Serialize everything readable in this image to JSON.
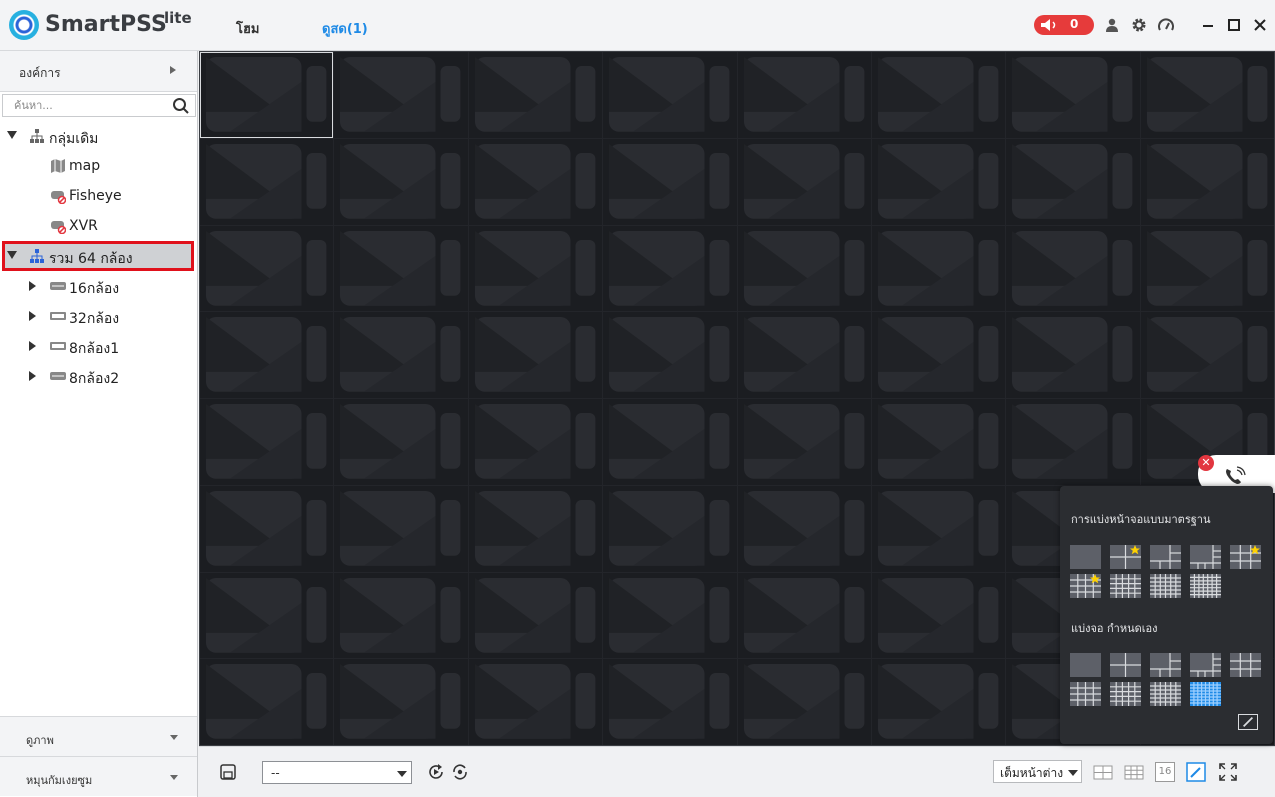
{
  "titlebar": {
    "brand": "SmartPSS",
    "brand_suffix": "lite",
    "tabs": [
      {
        "label": "โฮม"
      },
      {
        "label": "ดูสด(1)"
      }
    ],
    "alarm_count": "0"
  },
  "sidebar": {
    "org_header": "องค์การ",
    "search_placeholder": "ค้นหา...",
    "tree": [
      {
        "label": "กลุ่มเดิม",
        "icon": "org-tree-icon"
      },
      {
        "label": "map",
        "icon": "map-icon"
      },
      {
        "label": "Fisheye",
        "icon": "offline-device-icon"
      },
      {
        "label": "XVR",
        "icon": "offline-device-icon"
      },
      {
        "label": "รวม 64 กล้อง",
        "icon": "org-tree-icon"
      },
      {
        "label": "16กล้อง",
        "icon": "recorder-icon"
      },
      {
        "label": "32กล้อง",
        "icon": "recorder-icon"
      },
      {
        "label": "8กล้อง1",
        "icon": "recorder-icon"
      },
      {
        "label": "8กล้อง2",
        "icon": "recorder-icon"
      }
    ],
    "bottom_panels": [
      {
        "label": "ดูภาพ"
      },
      {
        "label": "หมุนกัมเงยซูม"
      }
    ]
  },
  "bottombar": {
    "view_select_value": "--",
    "fit_select_value": "เต็มหน้าต่าง",
    "split_count_label": "16"
  },
  "split_popup": {
    "standard_title": "การแบ่งหน้าจอแบบมาตรฐาน",
    "custom_title": "แบ่งจอ กำหนดเอง"
  },
  "colors": {
    "accent": "#1e8ae6",
    "alarm": "#e63b3b",
    "highlight_border": "#e0111b",
    "grid_bg": "#1b1d21"
  }
}
